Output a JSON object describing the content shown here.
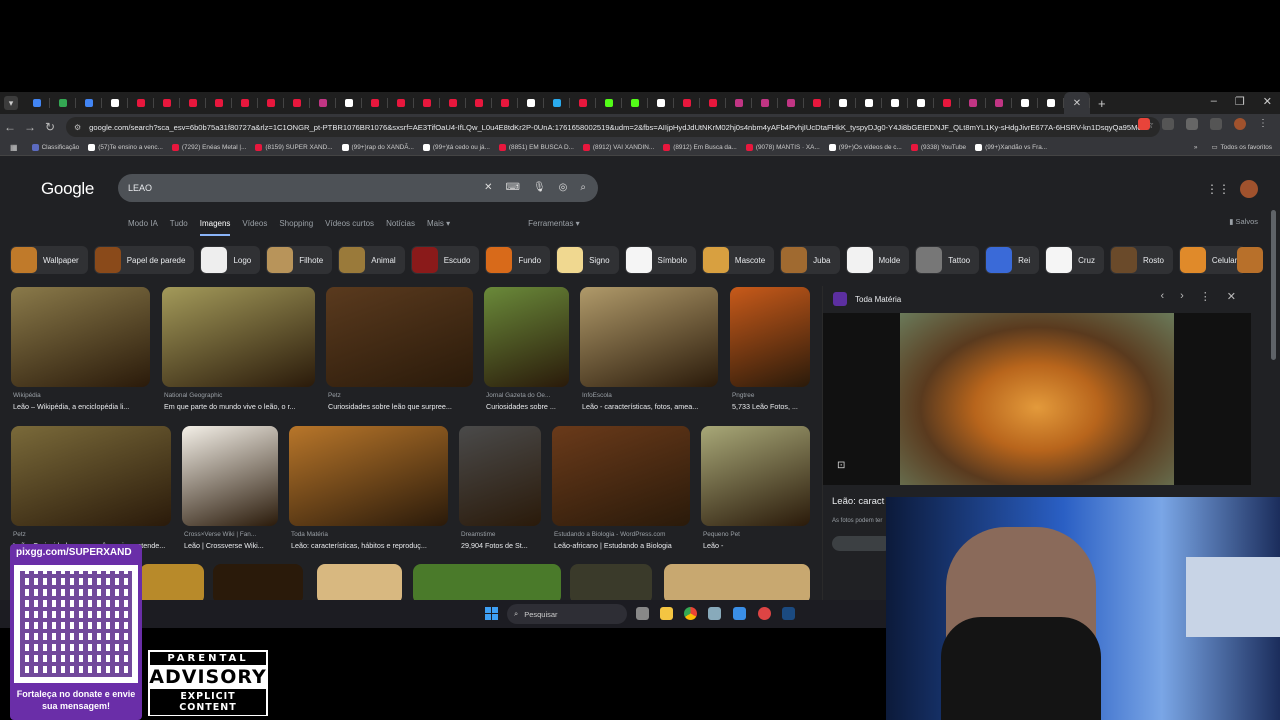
{
  "browser": {
    "url": "google.com/search?sca_esv=6b0b75a31f80727a&rlz=1C1ONGR_pt-PTBR1076BR1076&sxsrf=AE3TifOaU4-IfLQw_L0u4E8tdKr2P-0UnA:1761658002519&udm=2&fbs=AIIjpHydJdUtNKrM02hj0s4nbm4yAFb4PvhjIUcDtaFHkK_tyspyDJg0-Y4Ji8bGEtEDNJF_QLt8mYL1Ky-sHdgJivrE677A-6HSRV-kn1DsqyQa95Mc...",
    "tab_colors": [
      "#4285f4",
      "#34a853",
      "#4285f4",
      "#ffffff",
      "#e8173d",
      "#e8173d",
      "#e8173d",
      "#e8173d",
      "#e8173d",
      "#e8173d",
      "#e8173d",
      "#c13584",
      "#ffffff",
      "#e8173d",
      "#e8173d",
      "#e8173d",
      "#e8173d",
      "#e8173d",
      "#e8173d",
      "#ffffff",
      "#2aabee",
      "#e8173d",
      "#53fc18",
      "#53fc18",
      "#ffffff",
      "#e8173d",
      "#e8173d",
      "#c13584",
      "#c13584",
      "#c13584",
      "#e8173d",
      "#ffffff",
      "#ffffff",
      "#ffffff",
      "#ffffff",
      "#e8173d",
      "#c13584",
      "#c13584",
      "#ffffff",
      "#ffffff",
      "#9aa0a6"
    ],
    "new_tab_glyph": "+",
    "close_glyph": "✕",
    "window_controls": [
      "–",
      "❐",
      "✕"
    ]
  },
  "bookmarks": [
    {
      "label": "Classificação",
      "color": "#5c6bc0"
    },
    {
      "label": "(57)Te ensino a venc...",
      "color": "#ffffff"
    },
    {
      "label": "(7292) Enéas Metal |...",
      "color": "#e8173d"
    },
    {
      "label": "(8159) SUPER XAND...",
      "color": "#e8173d"
    },
    {
      "label": "(99+)rap do XANDÃ...",
      "color": "#ffffff"
    },
    {
      "label": "(99+)tá cedo ou já...",
      "color": "#ffffff"
    },
    {
      "label": "(8851) EM BUSCA D...",
      "color": "#e8173d"
    },
    {
      "label": "(8912) VAI XANDIN...",
      "color": "#e8173d"
    },
    {
      "label": "(8912) Em Busca da...",
      "color": "#e8173d"
    },
    {
      "label": "(9078) MANTIS · XA...",
      "color": "#e8173d"
    },
    {
      "label": "(99+)Os vídeos de c...",
      "color": "#ffffff"
    },
    {
      "label": "(9338) YouTube",
      "color": "#e8173d"
    },
    {
      "label": "(99+)Xandão vs Fra...",
      "color": "#ffffff"
    }
  ],
  "all_bookmarks_label": "Todos os favoritos",
  "google": {
    "logo": "Google",
    "query": "LEAO",
    "filters": [
      "Modo IA",
      "Tudo",
      "Imagens",
      "Vídeos",
      "Shopping",
      "Vídeos curtos",
      "Notícias",
      "Mais ▾"
    ],
    "tools": "Ferramentas ▾",
    "saved": "Salvos"
  },
  "chips": [
    {
      "label": "Wallpaper",
      "color": "#c07a2a"
    },
    {
      "label": "Papel de parede",
      "color": "#8a4a1a"
    },
    {
      "label": "Logo",
      "color": "#eeeeee"
    },
    {
      "label": "Filhote",
      "color": "#b8945a"
    },
    {
      "label": "Animal",
      "color": "#9a7a3a"
    },
    {
      "label": "Escudo",
      "color": "#8a1a1a"
    },
    {
      "label": "Fundo",
      "color": "#d86a1a"
    },
    {
      "label": "Signo",
      "color": "#f0d890"
    },
    {
      "label": "Símbolo",
      "color": "#f5f5f5"
    },
    {
      "label": "Mascote",
      "color": "#d8a040"
    },
    {
      "label": "Juba",
      "color": "#a06a30"
    },
    {
      "label": "Molde",
      "color": "#f2f2f2"
    },
    {
      "label": "Tattoo",
      "color": "#777777"
    },
    {
      "label": "Rei",
      "color": "#3a6ad8"
    },
    {
      "label": "Cruz",
      "color": "#f5f5f5"
    },
    {
      "label": "Rosto",
      "color": "#6a4a2a"
    },
    {
      "label": "Celular",
      "color": "#e08a2a"
    }
  ],
  "results_row1": [
    {
      "source": "Wikipédia",
      "caption": "Leão – Wikipédia, a enciclopédia li...",
      "color": "#8a7a4a"
    },
    {
      "source": "National Geographic",
      "caption": "Em que parte do mundo vive o leão, o r...",
      "color": "#a39a5a"
    },
    {
      "source": "Petz",
      "caption": "Curiosidades sobre leão que surpree...",
      "color": "#5a3a1e"
    },
    {
      "source": "Jornal Gazeta do Oe...",
      "caption": "Curiosidades sobre ...",
      "color": "#6a8a3a"
    },
    {
      "source": "InfoEscola",
      "caption": "Leão - características, fotos, amea...",
      "color": "#b09a6a"
    },
    {
      "source": "Pngtree",
      "caption": "5,733 Leão Fotos, ...",
      "color": "#c85a1a"
    }
  ],
  "results_row2": [
    {
      "source": "Petz",
      "caption": "Leão: Curiosidades que você precisa entende...",
      "color": "#7a6a3a"
    },
    {
      "source": "Cross×Verse Wiki | Fan...",
      "caption": "Leão | Crossverse Wiki...",
      "color": "#f4f0e8"
    },
    {
      "source": "Toda Matéria",
      "caption": "Leão: características, hábitos e reproduç...",
      "color": "#b8762a"
    },
    {
      "source": "Dreamstime",
      "caption": "29,904 Fotos de St...",
      "color": "#4a4a4a"
    },
    {
      "source": "Estudando a Biologia - WordPress.com",
      "caption": "Leão-africano | Estudando a Biologia",
      "color": "#6a3a1a"
    },
    {
      "source": "Pequeno Pet",
      "caption": "Leão -",
      "color": "#a8a878"
    }
  ],
  "panel": {
    "source": "Toda Matéria",
    "title": "Leão: caract",
    "note": "As fotos podem ter"
  },
  "taskbar": {
    "search": "Pesquisar"
  },
  "stream": {
    "pix_url": "pixgg.com/SUPERXAND",
    "pix_text": "Fortaleça no donate e envie sua mensagem!",
    "advisory_top": "PARENTAL",
    "advisory_main": "ADVISORY",
    "advisory_bottom": "EXPLICIT CONTENT"
  }
}
